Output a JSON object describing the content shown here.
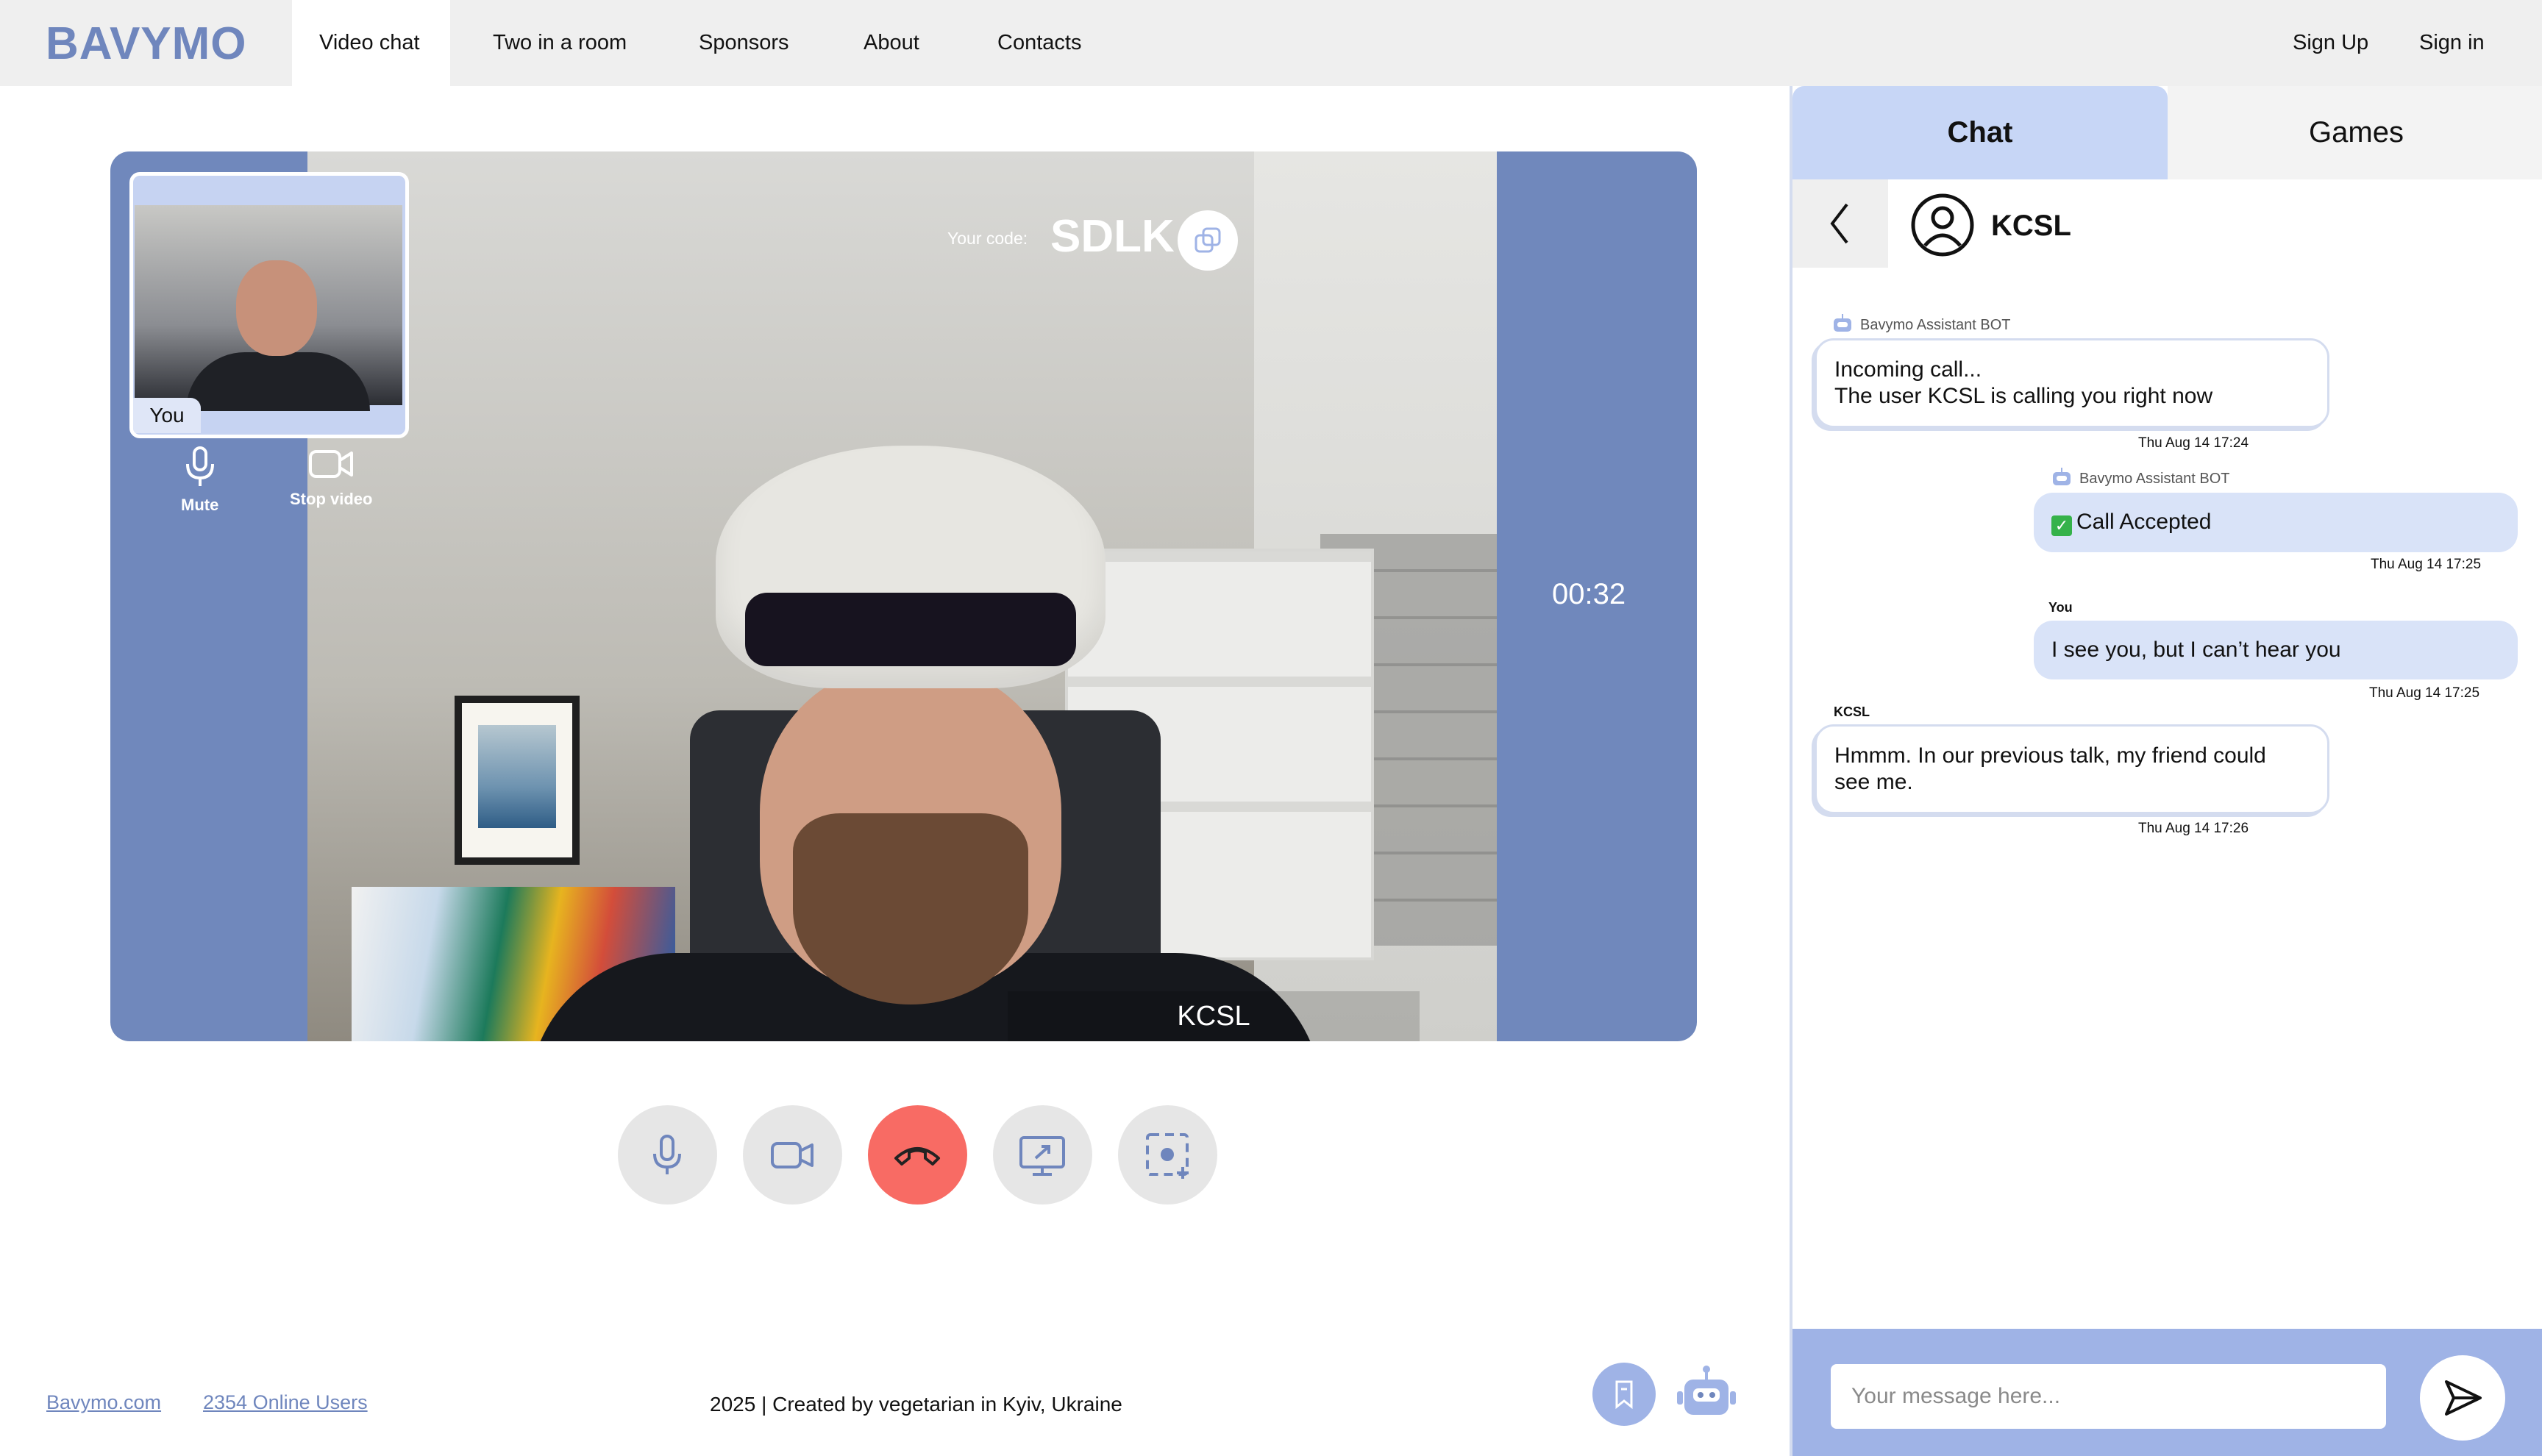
{
  "brand": {
    "logo": "BAVYMO",
    "color": "#6f86bd"
  },
  "nav": {
    "items": [
      {
        "label": "Video chat",
        "active": true
      },
      {
        "label": "Two in a room"
      },
      {
        "label": "Sponsors"
      },
      {
        "label": "About"
      },
      {
        "label": "Contacts"
      }
    ],
    "signup": "Sign Up",
    "signin": "Sign in"
  },
  "video": {
    "code_label": "Your code:",
    "code_value": "SDLK",
    "remote_name": "KCSL",
    "timer": "00:32",
    "self_label": "You",
    "mini_controls": {
      "mute": "Mute",
      "stop_video": "Stop video"
    },
    "accent": "#7088bc"
  },
  "controls": [
    {
      "icon": "microphone-icon"
    },
    {
      "icon": "camera-icon"
    },
    {
      "icon": "hangup-icon",
      "color": "#f86b64"
    },
    {
      "icon": "screen-share-icon"
    },
    {
      "icon": "screenshot-icon"
    }
  ],
  "footer": {
    "site_link": "Bavymo.com",
    "online_users": "2354 Online Users",
    "credit": "2025 | Created by vegetarian in Kyiv, Ukraine"
  },
  "chat_panel": {
    "tabs": {
      "chat": "Chat",
      "games": "Games"
    },
    "peer": "KCSL",
    "messages": [
      {
        "sender": "Bavymo Assistant BOT",
        "line1": "Incoming call...",
        "line2": "The user KCSL is calling you right now",
        "time": "Thu Aug 14  17:24"
      },
      {
        "sender": "Bavymo Assistant BOT",
        "text": "Call Accepted",
        "time": "Thu Aug 14  17:25"
      },
      {
        "sender": "You",
        "text": "I see you, but I can’t hear you",
        "time": "Thu Aug 14  17:25"
      },
      {
        "sender": "KCSL",
        "line1": "Hmmm. In our previous talk, my friend could",
        "line2": "see me.",
        "time": "Thu Aug 14  17:26"
      }
    ],
    "input_placeholder": "Your message here...",
    "accent": "#9fb3e6"
  }
}
